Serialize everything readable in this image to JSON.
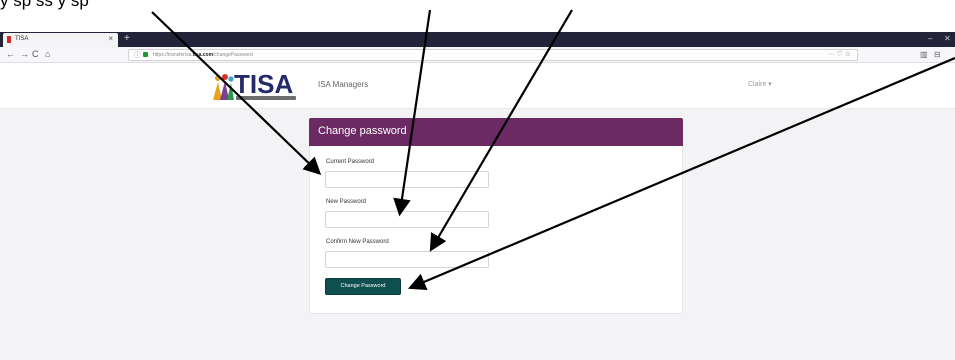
{
  "caption": {
    "text": "y         sp                             ss                                 y         sp"
  },
  "browser": {
    "tab_title": "TISA",
    "tab_close": "×",
    "new_tab": "+",
    "minimize": "–",
    "close": "✕",
    "back": "←",
    "forward": "→",
    "reload": "C",
    "home": "⌂",
    "url_prefix": "https://transferisa.",
    "url_host": "tisa.com",
    "url_path": "/changePassword",
    "url_actions": "··· ♡ ☆",
    "tools_left": "▥",
    "tools_right": "⊟"
  },
  "header": {
    "logo_text": "TISA",
    "brand": "ISA Managers",
    "user_menu": "Claire ▾"
  },
  "form": {
    "title": "Change password",
    "current_label": "Current Password",
    "new_label": "New Password",
    "confirm_label": "Confirm New Password",
    "submit_label": "Change Password"
  },
  "colors": {
    "header_bar": "#6b2a63",
    "button": "#0f4f4f",
    "logo": "#262a6b",
    "browser_tabbar": "#23233a"
  }
}
